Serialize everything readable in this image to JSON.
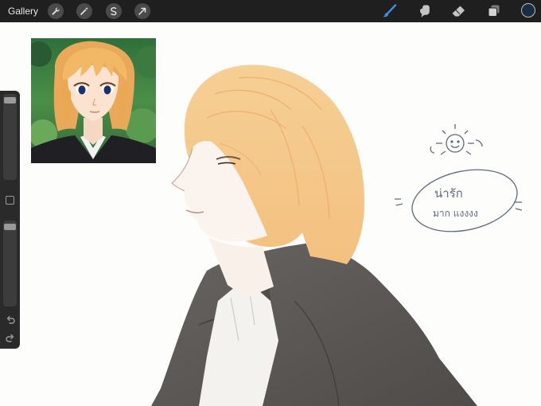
{
  "app": {
    "gallery_label": "Gallery"
  },
  "toolbar": {
    "actions": [
      "wrench-icon",
      "magic-wand-icon",
      "selection-icon",
      "transform-arrow-icon"
    ],
    "tools": [
      "brush-icon",
      "smudge-icon",
      "eraser-icon",
      "layers-icon"
    ],
    "active_tool": "brush",
    "active_color": "#1b2d44",
    "accent": "#3a8ee6"
  },
  "canvas": {
    "doodle_line1": "น่ารัก",
    "doodle_line2": "มาก แงงงง"
  }
}
